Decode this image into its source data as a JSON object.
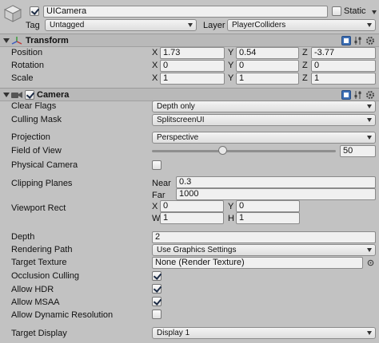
{
  "object": {
    "name": "UICamera",
    "active": true,
    "static_label": "Static",
    "static_checked": false,
    "tag_label": "Tag",
    "tag_value": "Untagged",
    "layer_label": "Layer",
    "layer_value": "PlayerColliders"
  },
  "transform": {
    "title": "Transform",
    "rows": [
      {
        "label": "Position",
        "x": "1.73",
        "y": "0.54",
        "z": "-3.77"
      },
      {
        "label": "Rotation",
        "x": "0",
        "y": "0",
        "z": "0"
      },
      {
        "label": "Scale",
        "x": "1",
        "y": "1",
        "z": "1"
      }
    ],
    "axis_x": "X",
    "axis_y": "Y",
    "axis_z": "Z"
  },
  "camera": {
    "title": "Camera",
    "enabled": true,
    "clear_flags_label": "Clear Flags",
    "clear_flags_value": "Depth only",
    "culling_mask_label": "Culling Mask",
    "culling_mask_value": "SplitscreenUI",
    "projection_label": "Projection",
    "projection_value": "Perspective",
    "fov_label": "Field of View",
    "fov_value": "50",
    "fov_level": 0.38,
    "physical_label": "Physical Camera",
    "physical_checked": false,
    "clipping_label": "Clipping Planes",
    "near_label": "Near",
    "near_value": "0.3",
    "far_label": "Far",
    "far_value": "1000",
    "viewport_label": "Viewport Rect",
    "vp_x_label": "X",
    "vp_x": "0",
    "vp_y_label": "Y",
    "vp_y": "0",
    "vp_w_label": "W",
    "vp_w": "1",
    "vp_h_label": "H",
    "vp_h": "1",
    "depth_label": "Depth",
    "depth_value": "2",
    "rendering_path_label": "Rendering Path",
    "rendering_path_value": "Use Graphics Settings",
    "target_texture_label": "Target Texture",
    "target_texture_value": "None (Render Texture)",
    "occlusion_label": "Occlusion Culling",
    "occlusion_checked": true,
    "hdr_label": "Allow HDR",
    "hdr_checked": true,
    "msaa_label": "Allow MSAA",
    "msaa_checked": true,
    "dynres_label": "Allow Dynamic Resolution",
    "dynres_checked": false,
    "target_display_label": "Target Display",
    "target_display_value": "Display 1"
  },
  "colors": {
    "panel_bg": "#c2c2c2",
    "slider_thumb": "#e8e8e8",
    "checkbox_mark": "#1b2a44"
  }
}
